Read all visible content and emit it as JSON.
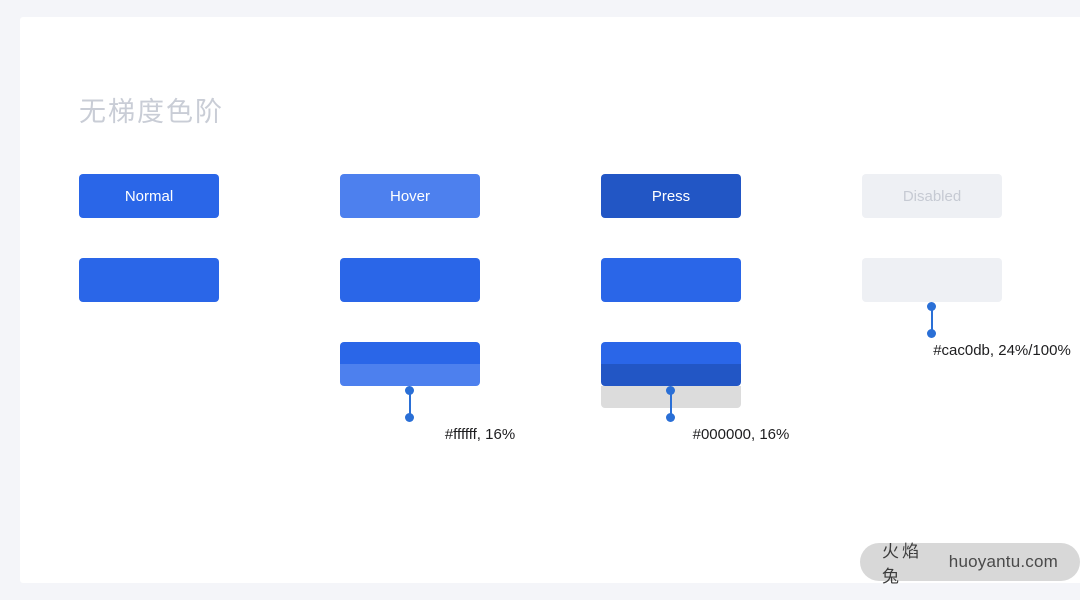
{
  "page": {
    "background_color": "#f4f5f9",
    "card_color": "#ffffff",
    "section_title": "无梯度色阶"
  },
  "columns": [
    {
      "key": "normal",
      "button": {
        "label": "Normal",
        "background": "#2a66e8",
        "text_color": "#ffffff"
      },
      "base_swatch": {
        "color": "#2a66e8"
      },
      "overlay_swatch": null,
      "annotation": null
    },
    {
      "key": "hover",
      "button": {
        "label": "Hover",
        "background": "#4d80ee",
        "text_color": "#ffffff"
      },
      "base_swatch": {
        "color": "#2a66e8"
      },
      "overlay_swatch": {
        "top_color": "#2a66e8",
        "bottom_color": "#4d80ee"
      },
      "annotation": {
        "text": "#ffffff, 16%",
        "overlay_color": "#ffffff",
        "overlay_opacity": "16%"
      }
    },
    {
      "key": "press",
      "button": {
        "label": "Press",
        "background": "#2256c5",
        "text_color": "#ffffff"
      },
      "base_swatch": {
        "color": "#2a66e8"
      },
      "overlay_swatch": {
        "top_color": "#2a66e8",
        "bottom_color": "#2256c5"
      },
      "band": {
        "color": "#dcdcdc"
      },
      "annotation": {
        "text": "#000000, 16%",
        "overlay_color": "#000000",
        "overlay_opacity": "16%"
      }
    },
    {
      "key": "disabled",
      "button": {
        "label": "Disabled",
        "background": "#eef0f4",
        "text_color": "#c6cad3"
      },
      "base_swatch": {
        "color": "#eef0f4"
      },
      "overlay_swatch": null,
      "annotation": {
        "text": "#cac0db, 24%/100%",
        "overlay_color": "#cac0db",
        "overlay_opacity": "24%/100%"
      }
    }
  ],
  "connector": {
    "color": "#2a6fd6"
  },
  "watermark": {
    "cn_text": "火焰兔",
    "en_text": "huoyantu.com",
    "pill_color": "#d8d8d8"
  }
}
